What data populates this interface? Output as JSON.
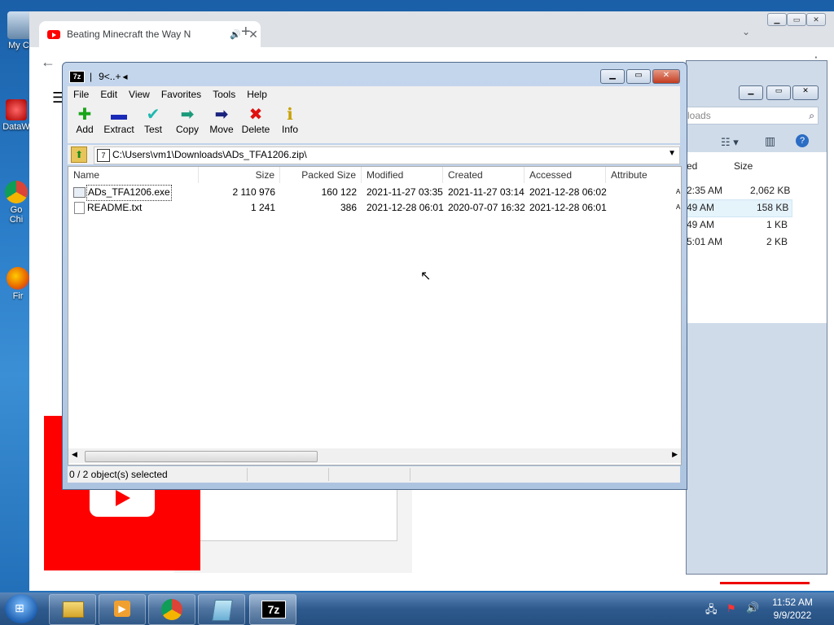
{
  "desktop": {
    "icons": [
      {
        "label": "My Co",
        "icon": "computer-icon"
      },
      {
        "label": "DataW",
        "icon": "shortcut-icon"
      },
      {
        "label": "Go",
        "label2": "Chi",
        "icon": "chrome-icon"
      },
      {
        "label": "Fir",
        "icon": "firefox-icon"
      }
    ]
  },
  "chrome": {
    "tab_title": "Beating Minecraft the Way N",
    "tab_close": "✕",
    "new_tab": "+",
    "colors": {
      "youtube_red": "#ff0000"
    }
  },
  "explorer": {
    "search_placeholder": "loads",
    "columns": {
      "modified_partial": "ed",
      "size": "Size"
    },
    "rows": [
      {
        "time": "2:35 AM",
        "size": "2,062 KB"
      },
      {
        "time": "49 AM",
        "size": "158 KB"
      },
      {
        "time": "49 AM",
        "size": "1 KB"
      },
      {
        "time": "5:01 AM",
        "size": "2 KB"
      }
    ]
  },
  "zip": {
    "title": "9<..+",
    "caption": {
      "minimize": "▁",
      "maximize": "▭",
      "close": "✕"
    },
    "menu": [
      "File",
      "Edit",
      "View",
      "Favorites",
      "Tools",
      "Help"
    ],
    "toolbar": [
      {
        "label": "Add",
        "icon": "add-icon",
        "glyph": "✚",
        "color": "#1aa51a"
      },
      {
        "label": "Extract",
        "icon": "extract-icon",
        "glyph": "▬",
        "color": "#1a2ab8"
      },
      {
        "label": "Test",
        "icon": "test-icon",
        "glyph": "✔",
        "color": "#1fb8b0"
      },
      {
        "label": "Copy",
        "icon": "copy-icon",
        "glyph": "➡",
        "color": "#1a9a7a"
      },
      {
        "label": "Move",
        "icon": "move-icon",
        "glyph": "➡",
        "color": "#1a237e"
      },
      {
        "label": "Delete",
        "icon": "delete-icon",
        "glyph": "✖",
        "color": "#e01010"
      },
      {
        "label": "Info",
        "icon": "info-icon",
        "glyph": "ℹ",
        "color": "#c8a000"
      }
    ],
    "path": "C:\\Users\\vm1\\Downloads\\ADs_TFA1206.zip\\",
    "headers": [
      "Name",
      "Size",
      "Packed Size",
      "Modified",
      "Created",
      "Accessed",
      "Attribute"
    ],
    "files": [
      {
        "name": "ADs_TFA1206.exe",
        "size": "2 110 976",
        "packed": "160 122",
        "modified": "2021-11-27 03:35",
        "created": "2021-11-27 03:14",
        "accessed": "2021-12-28 06:02",
        "attr": "A"
      },
      {
        "name": "README.txt",
        "size": "1 241",
        "packed": "386",
        "modified": "2021-12-28 06:01",
        "created": "2020-07-07 16:32",
        "accessed": "2021-12-28 06:01",
        "attr": "A"
      }
    ],
    "status": "0 / 2 object(s) selected"
  },
  "taskbar": {
    "time": "11:52 AM",
    "date": "9/9/2022",
    "apps": [
      "explorer-icon",
      "media-player-icon",
      "chrome-icon",
      "notepad-icon",
      "7zip-icon"
    ],
    "app_7z_label": "7z"
  }
}
